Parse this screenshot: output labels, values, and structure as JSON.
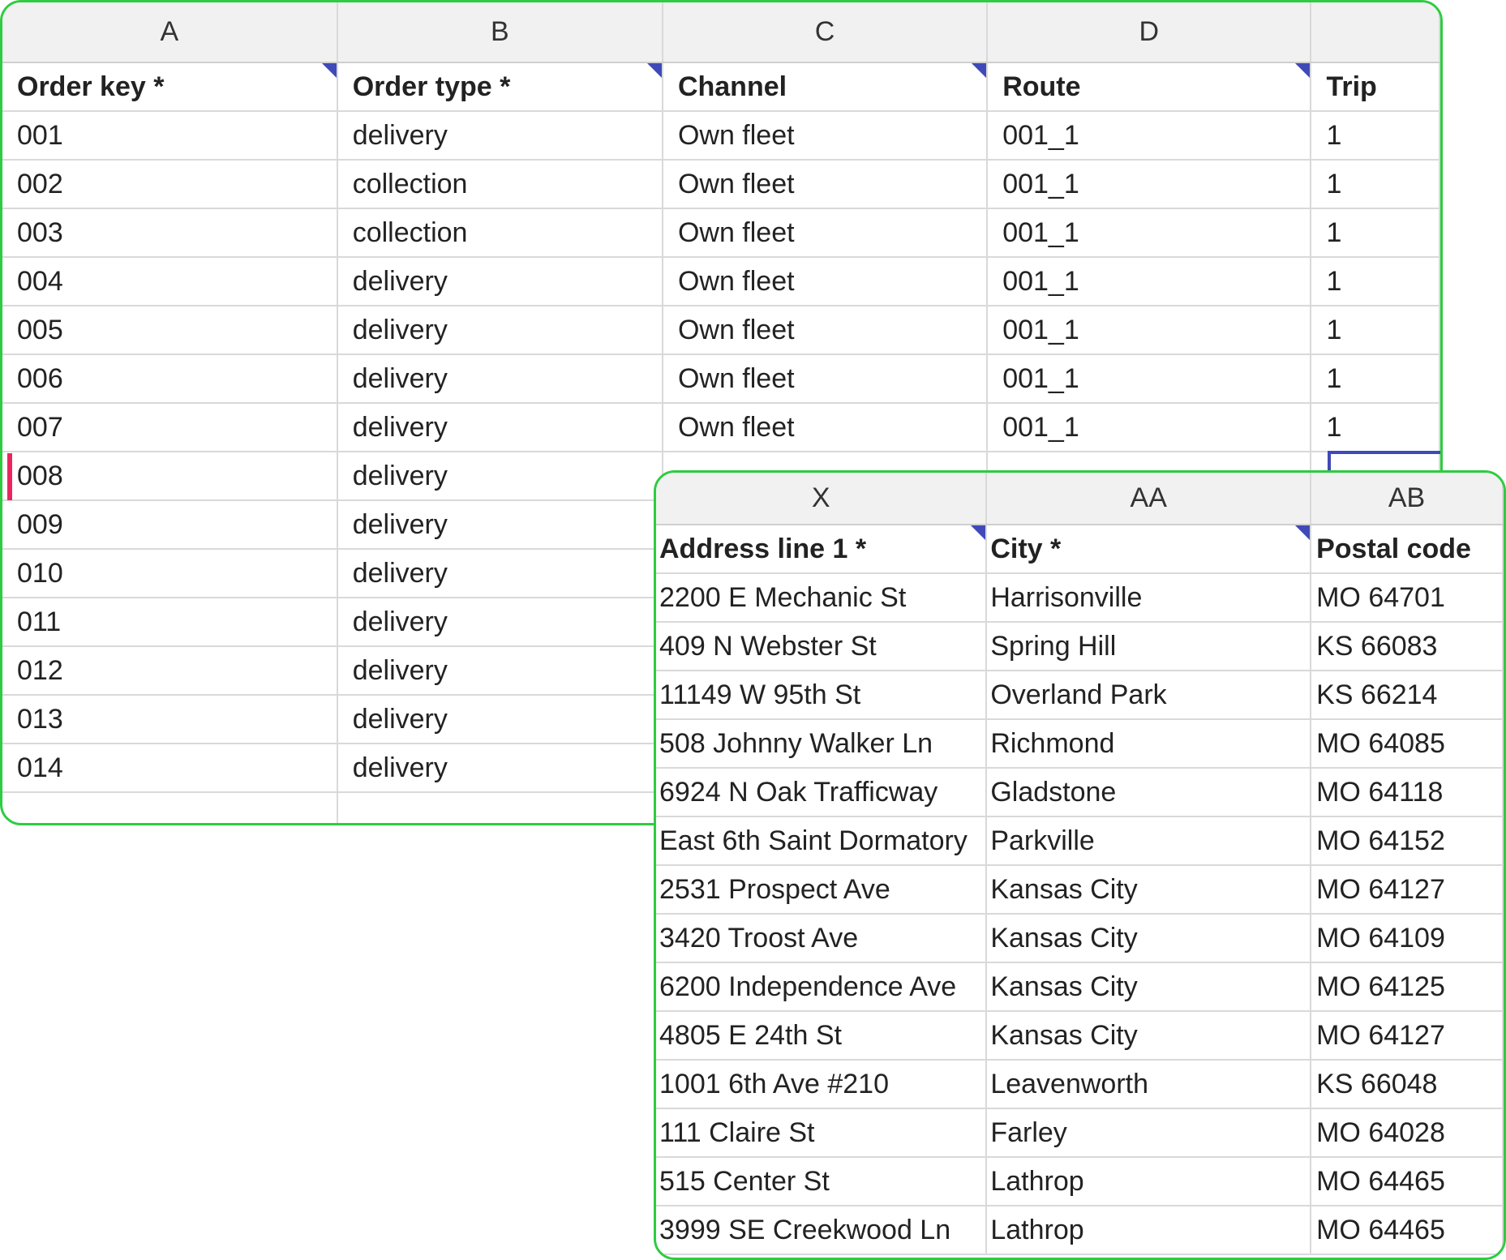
{
  "main_sheet": {
    "column_letters": [
      "A",
      "B",
      "C",
      "D",
      ""
    ],
    "headers": [
      {
        "label": "Order key *",
        "note": true
      },
      {
        "label": "Order type *",
        "note": true
      },
      {
        "label": "Channel",
        "note": true
      },
      {
        "label": "Route",
        "note": true
      },
      {
        "label": "Trip",
        "note": false
      }
    ],
    "rows": [
      [
        "001",
        "delivery",
        "Own fleet",
        "001_1",
        "1"
      ],
      [
        "002",
        "collection",
        "Own fleet",
        "001_1",
        "1"
      ],
      [
        "003",
        "collection",
        "Own fleet",
        "001_1",
        "1"
      ],
      [
        "004",
        "delivery",
        "Own fleet",
        "001_1",
        "1"
      ],
      [
        "005",
        "delivery",
        "Own fleet",
        "001_1",
        "1"
      ],
      [
        "006",
        "delivery",
        "Own fleet",
        "001_1",
        "1"
      ],
      [
        "007",
        "delivery",
        "Own fleet",
        "001_1",
        "1"
      ],
      [
        "008",
        "delivery",
        "",
        "",
        ""
      ],
      [
        "009",
        "delivery",
        "",
        "",
        ""
      ],
      [
        "010",
        "delivery",
        "",
        "",
        ""
      ],
      [
        "011",
        "delivery",
        "",
        "",
        ""
      ],
      [
        "012",
        "delivery",
        "",
        "",
        ""
      ],
      [
        "013",
        "delivery",
        "",
        "",
        ""
      ],
      [
        "014",
        "delivery",
        "",
        "",
        ""
      ]
    ],
    "active_row": "008",
    "accent_color": "#e8265e",
    "selection_color": "#3f4ab8"
  },
  "address_sheet": {
    "column_letters": [
      "X",
      "AA",
      "AB"
    ],
    "headers": [
      {
        "label": "Address line 1 *",
        "note": true
      },
      {
        "label": "City *",
        "note": true
      },
      {
        "label": "Postal code",
        "note": false
      }
    ],
    "rows": [
      [
        "2200 E Mechanic St",
        "Harrisonville",
        "MO 64701"
      ],
      [
        "409 N Webster St",
        "Spring Hill",
        "KS 66083"
      ],
      [
        "11149 W 95th St",
        "Overland Park",
        "KS 66214"
      ],
      [
        "508 Johnny Walker Ln",
        "Richmond",
        "MO 64085"
      ],
      [
        "6924 N Oak Trafficway",
        "Gladstone",
        "MO 64118"
      ],
      [
        "East 6th Saint Dormatory",
        "Parkville",
        "MO 64152"
      ],
      [
        "2531 Prospect Ave",
        "Kansas City",
        "MO 64127"
      ],
      [
        "3420 Troost Ave",
        "Kansas City",
        "MO 64109"
      ],
      [
        "6200 Independence Ave",
        "Kansas City",
        "MO 64125"
      ],
      [
        "4805 E 24th St",
        "Kansas City",
        "MO 64127"
      ],
      [
        "1001 6th Ave #210",
        "Leavenworth",
        "KS 66048"
      ],
      [
        "111 Claire St",
        "Farley",
        "MO 64028"
      ],
      [
        "515 Center St",
        "Lathrop",
        "MO 64465"
      ],
      [
        "3999 SE Creekwood Ln",
        "Lathrop",
        "MO 64465"
      ]
    ],
    "border_color": "#2ecc40"
  }
}
